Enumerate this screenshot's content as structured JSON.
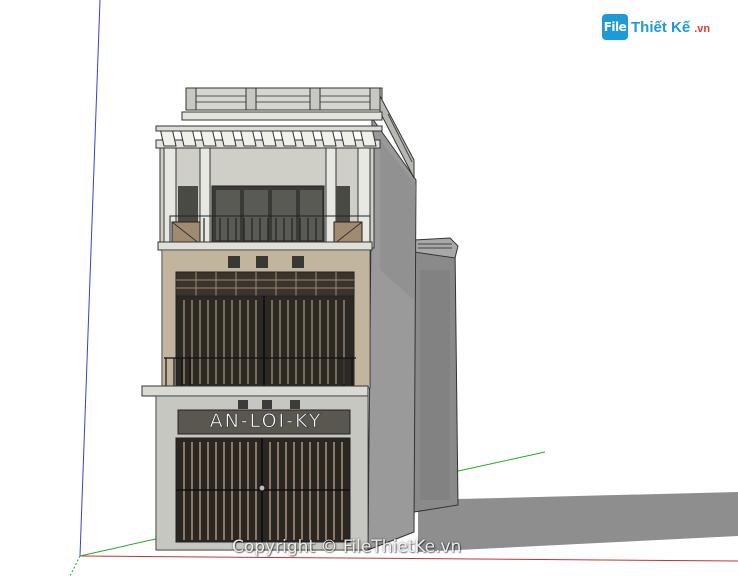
{
  "logo": {
    "icon_text": "File",
    "name": "Thiết Kế",
    "domain": ".vn"
  },
  "facade": {
    "sign_text": "AN-LOI-KY"
  },
  "watermark": {
    "text": "Copyright © FileThietKe.vn"
  },
  "colors": {
    "brand_blue": "#1e9ad6",
    "brand_red": "#e23a2b",
    "axis_red": "#c83232",
    "axis_green": "#22aa22",
    "axis_blue": "#3344cc",
    "shadow": "#8e8e8e"
  }
}
